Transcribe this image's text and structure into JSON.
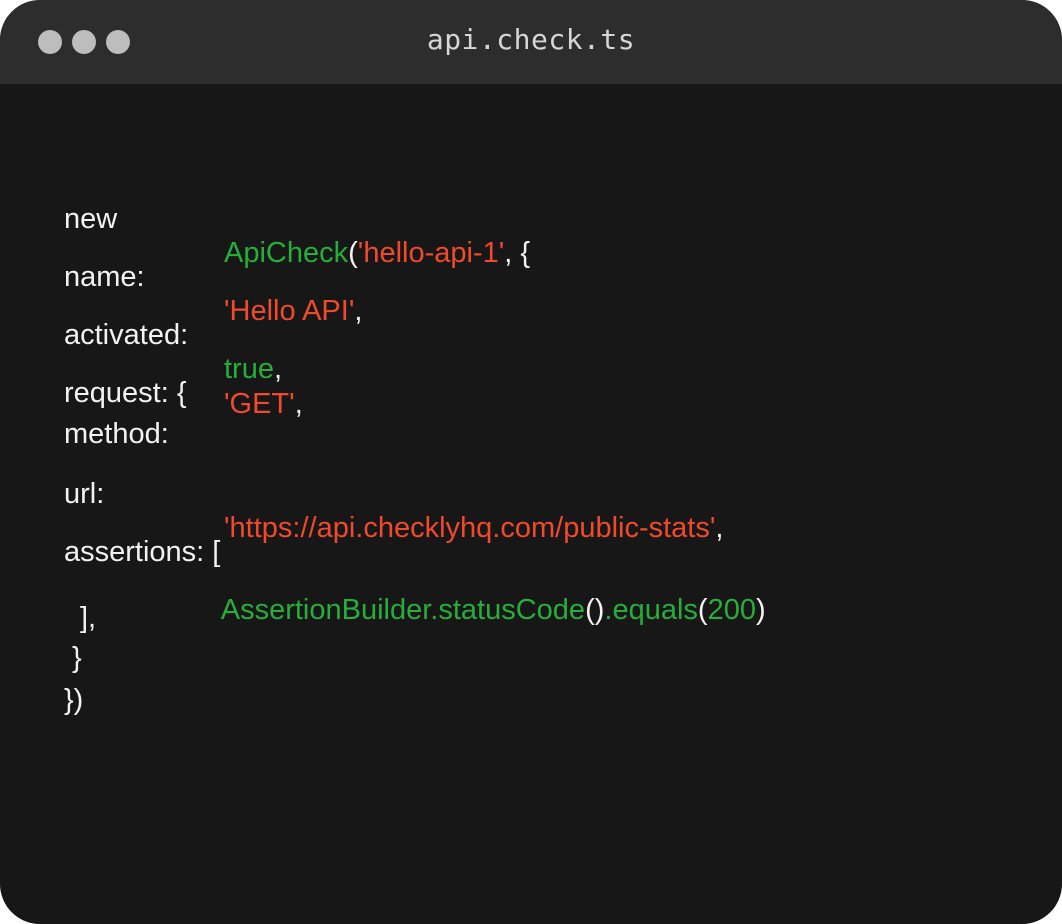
{
  "window": {
    "title": "api.check.ts",
    "controls": [
      "close-dot",
      "minimize-dot",
      "zoom-dot"
    ]
  },
  "code": {
    "line1": {
      "keyword": "new",
      "fn": "ApiCheck",
      "open": "(",
      "str": "'hello-api-1'",
      "tail": ", {"
    },
    "line2": {
      "key": "name:",
      "str": "'Hello API'",
      "tail": ","
    },
    "line3": {
      "key": "activated:",
      "bool": "true",
      "tail": ","
    },
    "line4": {
      "key": "request:",
      "tail": " {"
    },
    "line5": {
      "key": "method:",
      "str": "'GET'",
      "tail": ","
    },
    "line6": {
      "key": "url:",
      "str": "'https://api.checklyhq.com/public-stats'",
      "tail": ","
    },
    "line7": {
      "key": "assertions:",
      "tail": " ["
    },
    "line8": {
      "fn1": "AssertionBuilder.statusCode",
      "paren1": "()",
      "fn2": ".equals",
      "open": "(",
      "num": "200",
      "close": ")"
    },
    "line9": {
      "text": "],"
    },
    "line10": {
      "text": "}"
    },
    "line11": {
      "text": "})"
    }
  },
  "colors": {
    "background": "#171717",
    "titlebar": "#2d2d2d",
    "function": "#27ad3a",
    "string": "#f04a2a",
    "text": "#f2f2f2"
  }
}
